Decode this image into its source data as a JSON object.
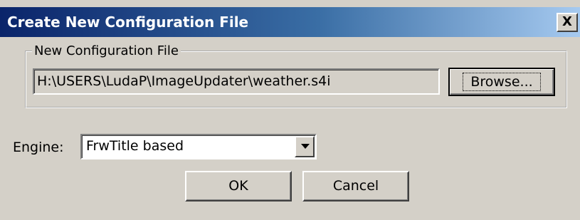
{
  "window": {
    "title": "Create New Configuration File",
    "close_label": "X"
  },
  "config_group": {
    "legend": "New Configuration File",
    "path_value": "H:\\USERS\\LudaP\\ImageUpdater\\weather.s4i",
    "browse_label": "Browse..."
  },
  "engine": {
    "label": "Engine:",
    "selected": "FrwTitle based"
  },
  "buttons": {
    "ok_label": "OK",
    "cancel_label": "Cancel"
  },
  "colors": {
    "dialog_face": "#d4d0c8",
    "titlebar_start": "#0a246a",
    "titlebar_end": "#a6caf0"
  },
  "icons": {
    "close": "close-icon",
    "dropdown": "chevron-down-icon"
  }
}
